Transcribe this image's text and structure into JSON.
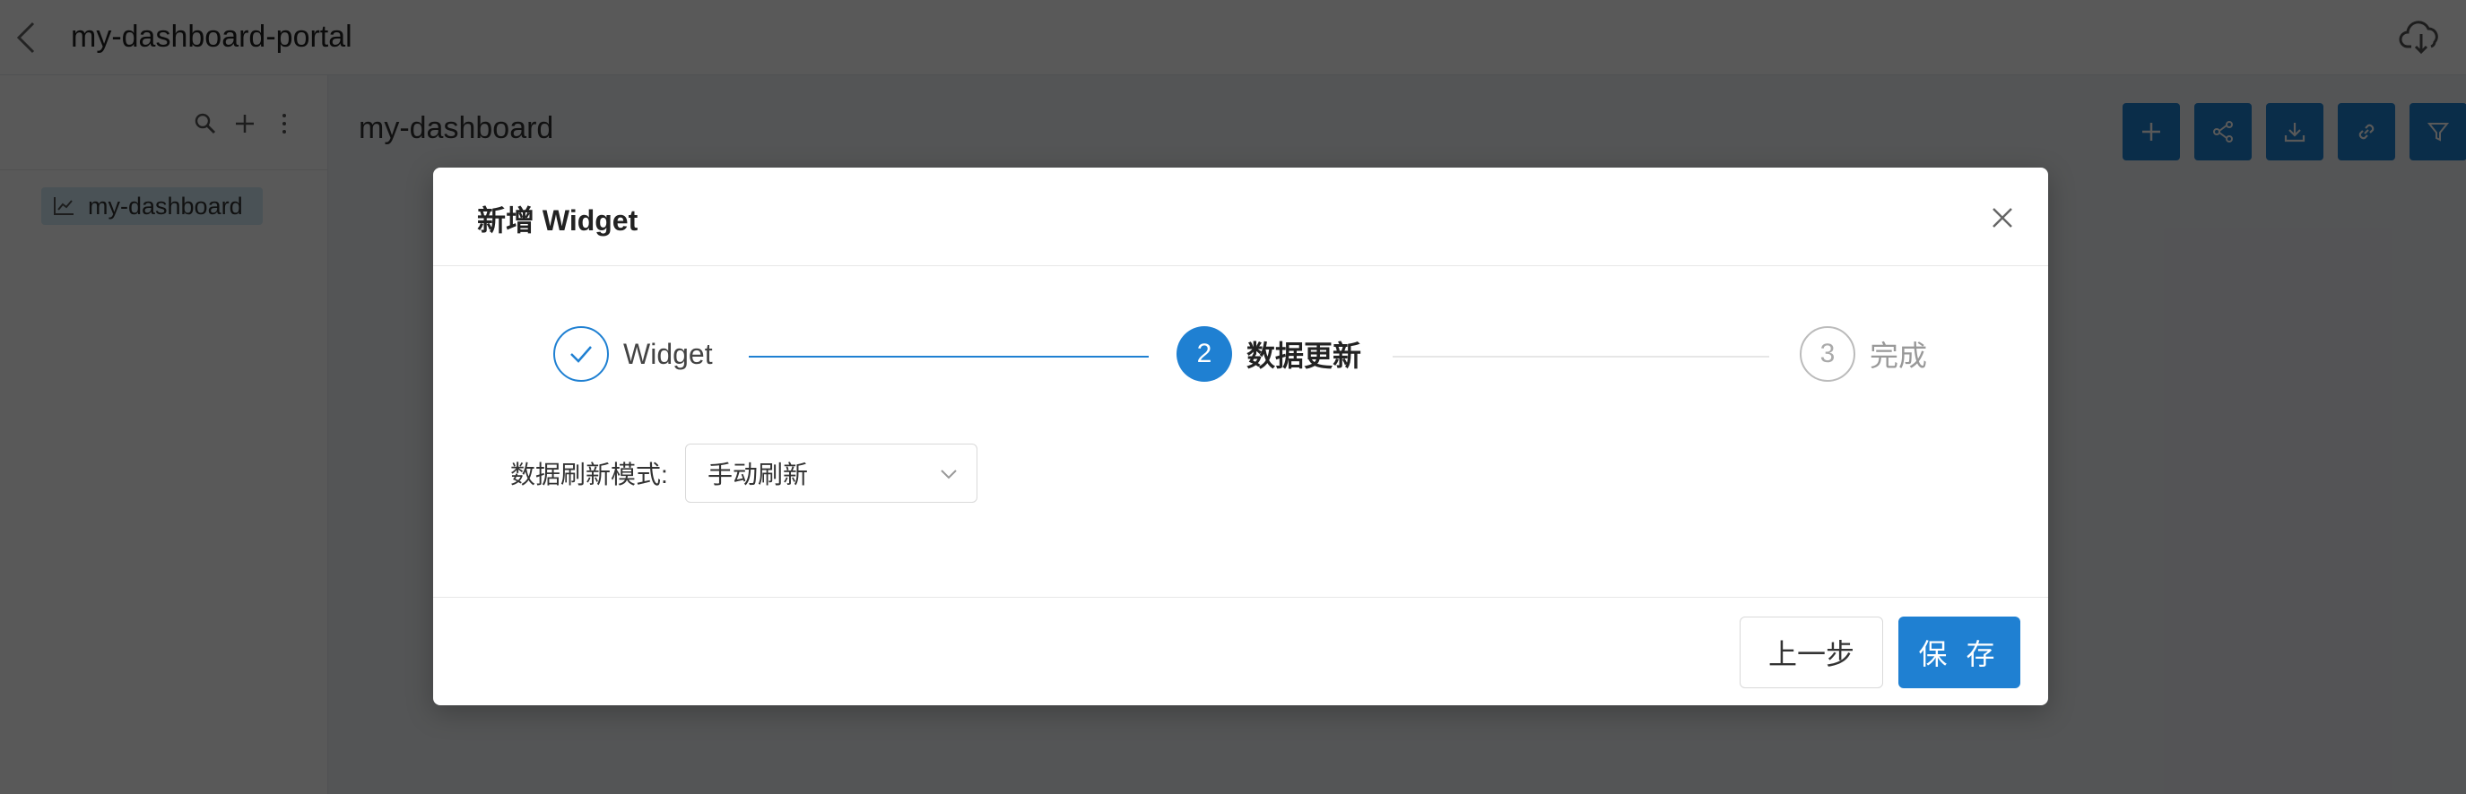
{
  "header": {
    "title": "my-dashboard-portal",
    "back_icon": "chevron-left-icon",
    "cloud_icon": "cloud-download-icon"
  },
  "sidebar": {
    "tools": [
      "search-icon",
      "plus-icon",
      "more-vertical-icon"
    ],
    "items": [
      {
        "label": "my-dashboard",
        "icon": "chart-icon"
      }
    ]
  },
  "main": {
    "title": "my-dashboard",
    "toolbar": [
      "plus-icon",
      "share-icon",
      "download-icon",
      "link-icon",
      "filter-icon"
    ]
  },
  "modal": {
    "title": "新增 Widget",
    "steps": [
      {
        "number": "1",
        "label": "Widget",
        "status": "finished"
      },
      {
        "number": "2",
        "label": "数据更新",
        "status": "active"
      },
      {
        "number": "3",
        "label": "完成",
        "status": "pending"
      }
    ],
    "form": {
      "refresh_mode_label": "数据刷新模式:",
      "refresh_mode_value": "手动刷新"
    },
    "buttons": {
      "prev": "上一步",
      "save": "保 存"
    }
  },
  "colors": {
    "primary": "#1f80d2",
    "tree_highlight": "#d4ecf6"
  }
}
